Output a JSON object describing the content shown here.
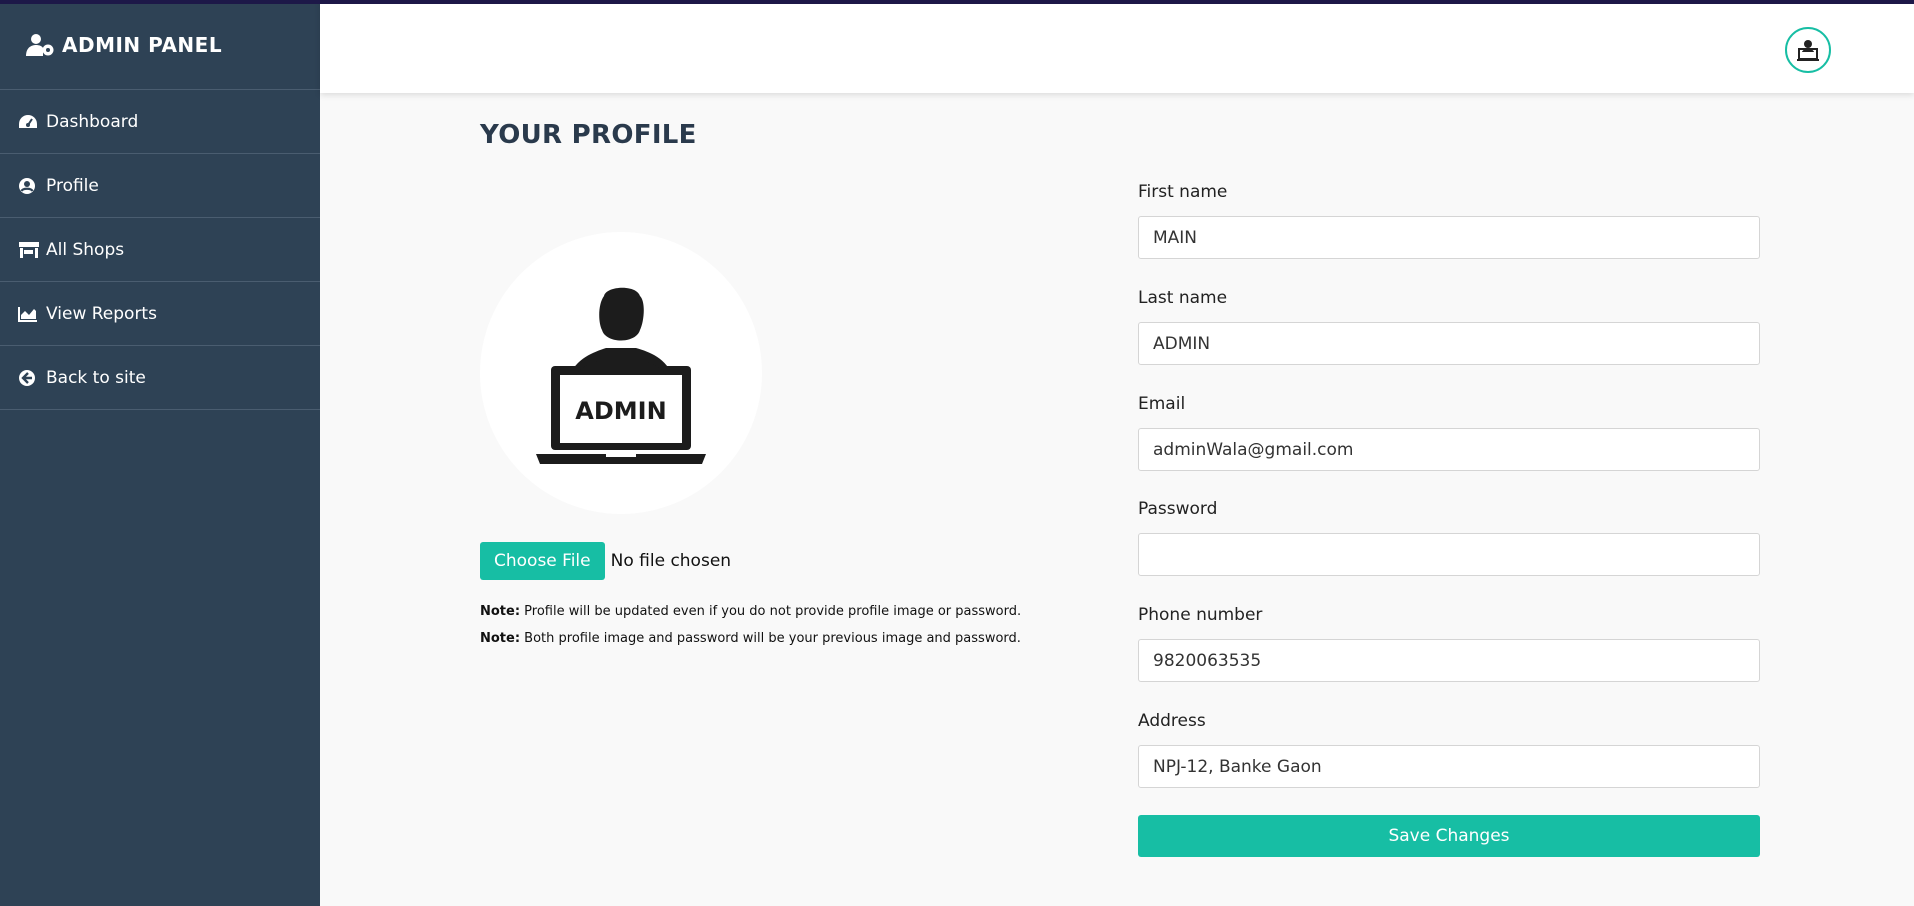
{
  "sidebar": {
    "brand": "ADMIN PANEL",
    "items": [
      {
        "label": "Dashboard",
        "icon": "dashboard-icon"
      },
      {
        "label": "Profile",
        "icon": "user-circle-icon"
      },
      {
        "label": "All Shops",
        "icon": "store-icon"
      },
      {
        "label": "View Reports",
        "icon": "chart-area-icon"
      },
      {
        "label": "Back to site",
        "icon": "arrow-circle-left-icon"
      }
    ]
  },
  "header": {
    "avatar_icon": "admin-avatar-icon"
  },
  "main": {
    "title": "YOUR PROFILE",
    "profile_image_text": "ADMIN",
    "file_button": "Choose File",
    "file_status": "No file chosen",
    "notes": [
      {
        "label": "Note:",
        "text": " Profile will be updated even if you do not provide profile image or password."
      },
      {
        "label": "Note:",
        "text": " Both profile image and password will be your previous image and password."
      }
    ]
  },
  "form": {
    "first_name_label": "First name",
    "first_name": "MAIN",
    "last_name_label": "Last name",
    "last_name": "ADMIN",
    "email_label": "Email",
    "email": "adminWala@gmail.com",
    "password_label": "Password",
    "password": "",
    "phone_label": "Phone number",
    "phone": "9820063535",
    "address_label": "Address",
    "address": "NPJ-12, Banke Gaon",
    "save_label": "Save Changes"
  },
  "colors": {
    "sidebar_bg": "#2e4255",
    "accent": "#17bea4",
    "page_bg": "#f9f9f9"
  }
}
